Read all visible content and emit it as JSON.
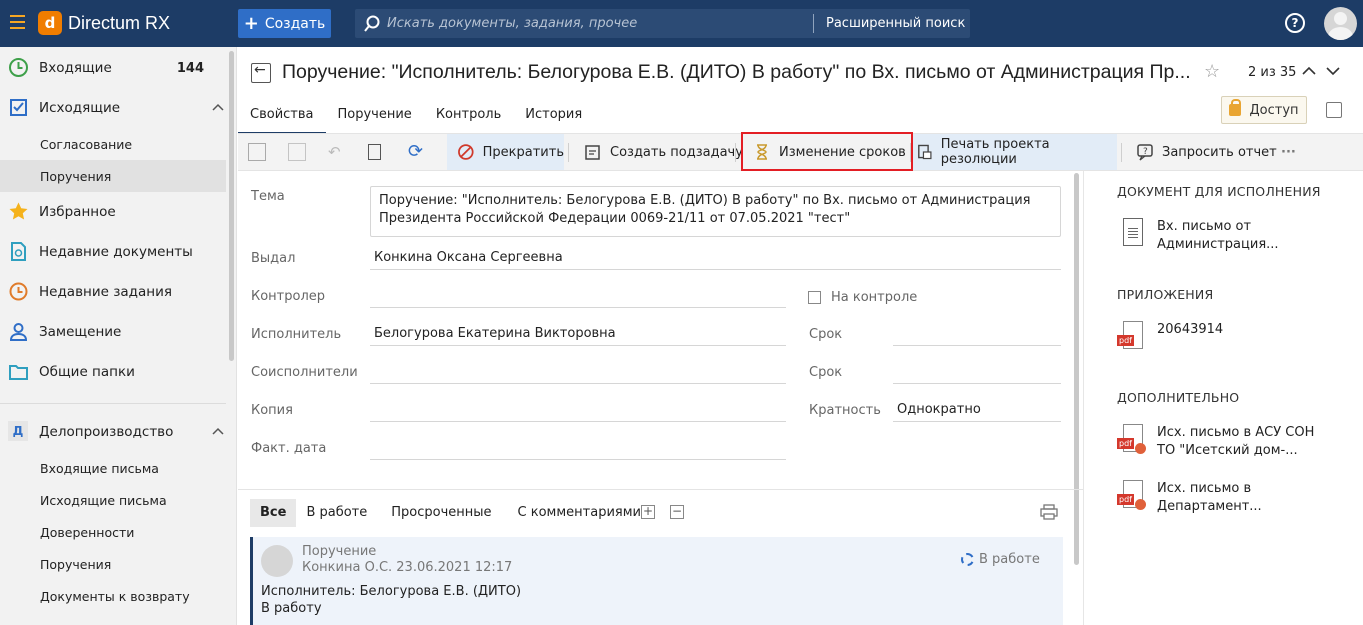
{
  "app": {
    "brand": "Directum RX"
  },
  "topbar": {
    "create_label": "Создать",
    "search_placeholder": "Искать документы, задания, прочее",
    "advanced_search": "Расширенный поиск",
    "help": "?"
  },
  "sidebar": {
    "items": [
      {
        "label": "Входящие",
        "count": "144"
      },
      {
        "label": "Исходящие"
      },
      {
        "label": "Согласование"
      },
      {
        "label": "Поручения"
      },
      {
        "label": "Избранное"
      },
      {
        "label": "Недавние документы"
      },
      {
        "label": "Недавние задания"
      },
      {
        "label": "Замещение"
      },
      {
        "label": "Общие папки"
      }
    ],
    "section": {
      "letter": "Д",
      "label": "Делопроизводство"
    },
    "section_items": [
      "Входящие письма",
      "Исходящие письма",
      "Доверенности",
      "Поручения",
      "Документы к возврату"
    ]
  },
  "header": {
    "title": "Поручение: \"Исполнитель: Белогурова Е.В. (ДИТО) В работу\" по Вх. письмо от Администрация Пр...",
    "pager": "2 из 35",
    "access_label": "Доступ"
  },
  "tabs": [
    "Свойства",
    "Поручение",
    "Контроль",
    "История"
  ],
  "toolbar": {
    "stop": "Прекратить",
    "subtask": "Создать подзадачу",
    "deadline": "Изменение сроков",
    "print_resolution": "Печать проекта резолюции",
    "request_report": "Запросить отчет",
    "more": "···"
  },
  "form": {
    "subject_label": "Тема",
    "subject_value": "Поручение: \"Исполнитель: Белогурова Е.В. (ДИТО) В работу\" по Вх. письмо от Администрация Президента Российской Федерации 0069-21/11 от 07.05.2021 \"тест\"",
    "issued_label": "Выдал",
    "issued_value": "Конкина Оксана Сергеевна",
    "controller_label": "Контролер",
    "controller_value": "",
    "on_control_label": "На контроле",
    "executor_label": "Исполнитель",
    "executor_value": "Белогурова Екатерина Викторовна",
    "deadline_label": "Срок",
    "deadline_value": "",
    "coexec_label": "Соисполнители",
    "coexec_value": "",
    "deadline2_label": "Срок",
    "deadline2_value": "",
    "copy_label": "Копия",
    "copy_value": "",
    "frequency_label": "Кратность",
    "frequency_value": "Однократно",
    "actual_date_label": "Факт. дата",
    "actual_date_value": ""
  },
  "thread": {
    "tabs": [
      "Все",
      "В работе",
      "Просроченные",
      "С комментариями"
    ],
    "note": {
      "type": "Поручение",
      "author_date": "Конкина О.С.   23.06.2021 12:17",
      "status": "В работе",
      "line1": "Исполнитель: Белогурова Е.В. (ДИТО)",
      "line2": "В работу"
    }
  },
  "right": {
    "doc_header": "ДОКУМЕНТ ДЛЯ ИСПОЛНЕНИЯ",
    "doc_item": "Вх. письмо от Администрация...",
    "attach_header": "ПРИЛОЖЕНИЯ",
    "attach_item": "20643914",
    "extra_header": "ДОПОЛНИТЕЛЬНО",
    "extra_items": [
      "Исх. письмо в АСУ СОН ТО \"Исетский дом-...",
      "Исх. письмо в Департамент..."
    ],
    "pdf_tag": "pdf"
  },
  "colors": {
    "topbar": "#1d3c66",
    "accent": "#2f6ec7",
    "highlight_box": "#e31e24",
    "brand_orange": "#f07d00"
  }
}
